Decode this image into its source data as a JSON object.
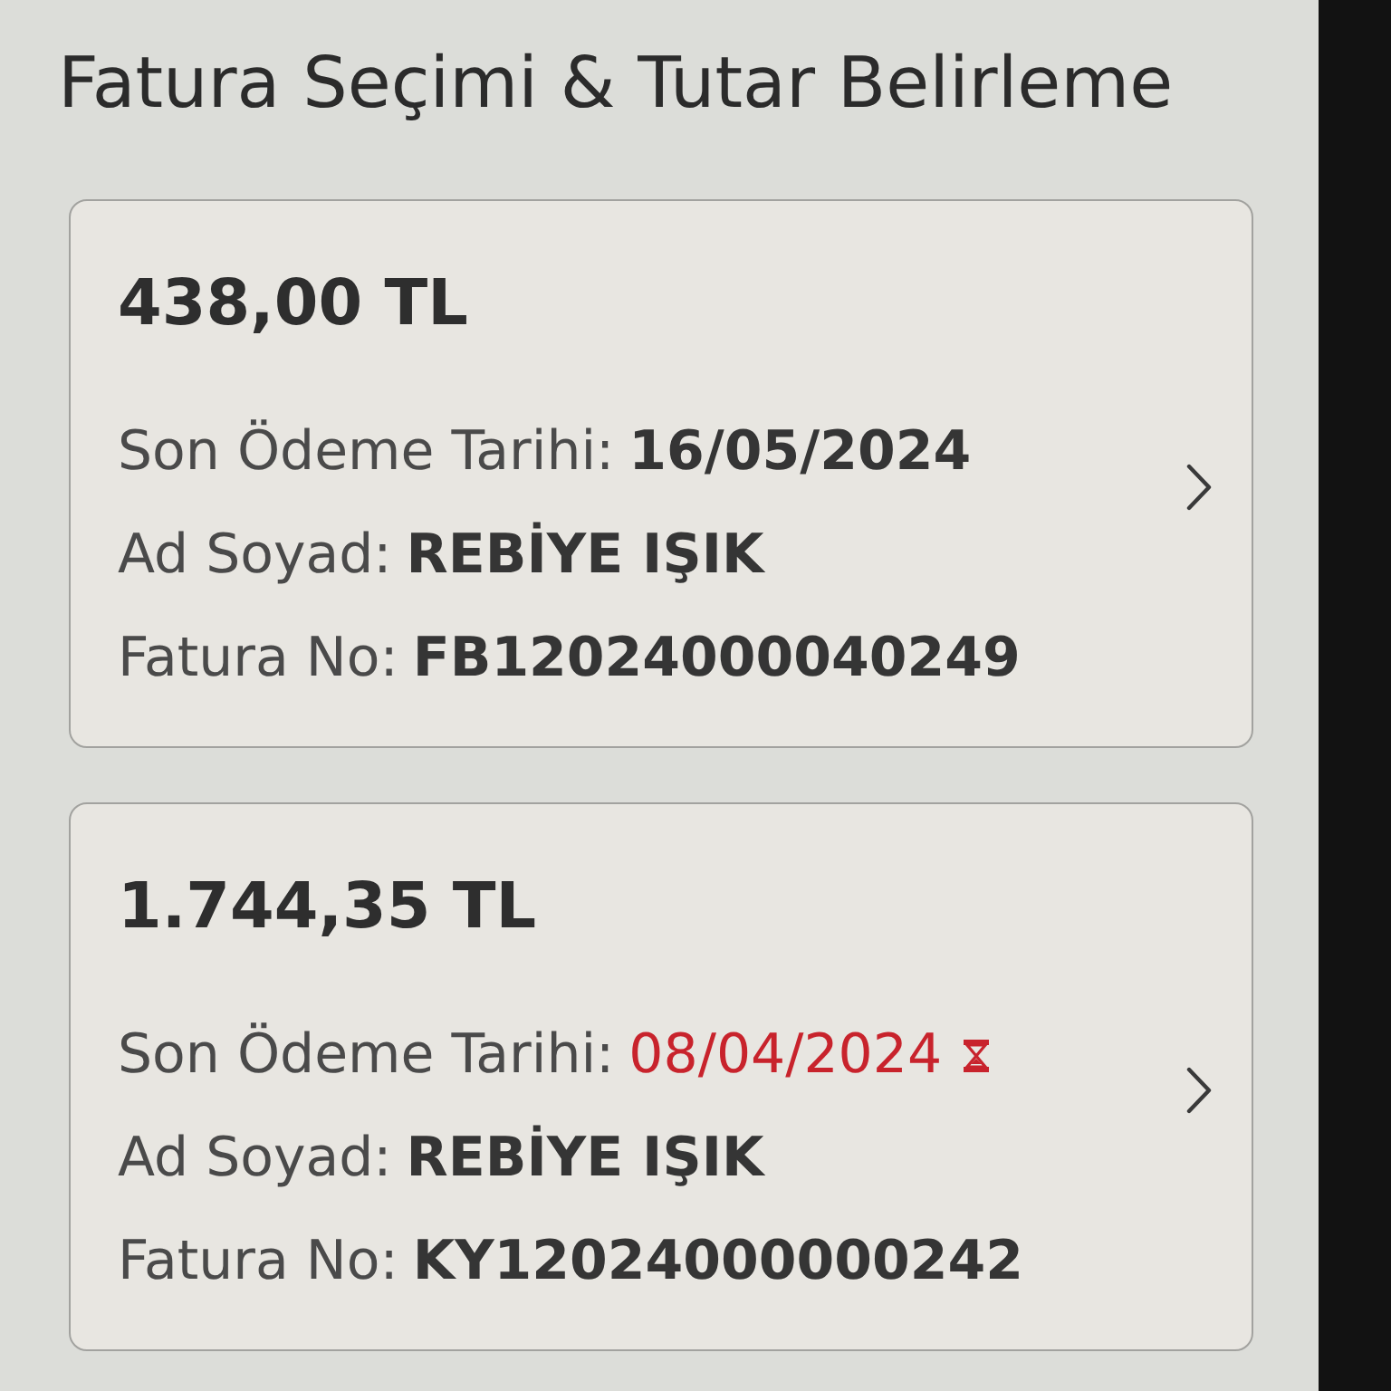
{
  "page": {
    "title": "Fatura Seçimi & Tutar Belirleme"
  },
  "invoices": [
    {
      "amount": "438,00 TL",
      "due_date_label": "Son Ödeme Tarihi:",
      "due_date": "16/05/2024",
      "overdue": false,
      "name_label": "Ad Soyad:",
      "name": "REBİYE IŞIK",
      "invoice_no_label": "Fatura No:",
      "invoice_no": "FB12024000040249"
    },
    {
      "amount": "1.744,35 TL",
      "due_date_label": "Son Ödeme Tarihi:",
      "due_date": "08/04/2024",
      "overdue": true,
      "name_label": "Ad Soyad:",
      "name": "REBİYE IŞIK",
      "invoice_no_label": "Fatura No:",
      "invoice_no": "KY12024000000242"
    }
  ]
}
